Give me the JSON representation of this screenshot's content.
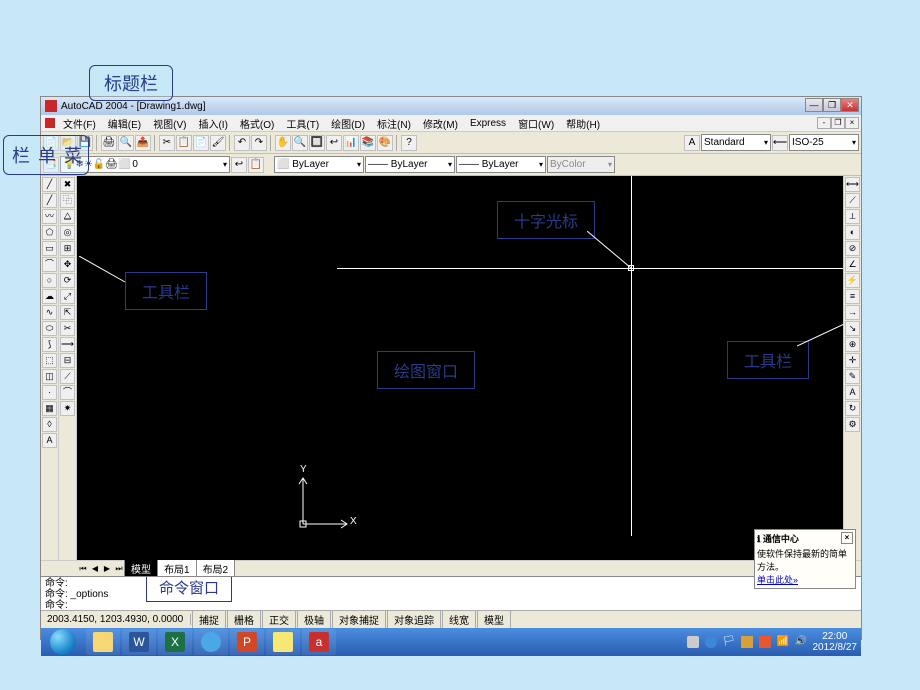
{
  "annotations": {
    "titlebar": "标题栏",
    "menubar": "菜\n单\n栏",
    "toolbar_left": "工具栏",
    "toolbar_right": "工具栏",
    "crosshair": "十字光标",
    "drawing_area": "绘图窗口",
    "command_window": "命令窗口"
  },
  "title": {
    "app": "AutoCAD 2004 - [Drawing1.dwg]"
  },
  "menu": {
    "items": [
      "文件(F)",
      "编辑(E)",
      "视图(V)",
      "插入(I)",
      "格式(O)",
      "工具(T)",
      "绘图(D)",
      "标注(N)",
      "修改(M)",
      "Express",
      "窗口(W)",
      "帮助(H)"
    ]
  },
  "toolbar2": {
    "text_style": "Standard",
    "dim_style": "ISO-25"
  },
  "layerbar": {
    "layer": "0",
    "color": "ByLayer",
    "linetype": "ByLayer",
    "lineweight": "ByLayer",
    "plot_style": "ByColor"
  },
  "ucs": {
    "x": "X",
    "y": "Y"
  },
  "tabs": {
    "model": "模型",
    "layout1": "布局1",
    "layout2": "布局2"
  },
  "command": {
    "line1": "命令:",
    "line2": "命令: _options",
    "line3": "命令:"
  },
  "status": {
    "coords": "2003.4150, 1203.4930, 0.0000",
    "buttons": [
      "捕捉",
      "栅格",
      "正交",
      "极轴",
      "对象捕捉",
      "对象追踪",
      "线宽",
      "模型"
    ]
  },
  "comm_center": {
    "title": "通信中心",
    "text": "使软件保持最新的简单方法。",
    "link": "单击此处»"
  },
  "taskbar": {
    "time": "22:00",
    "date": "2012/8/27"
  }
}
